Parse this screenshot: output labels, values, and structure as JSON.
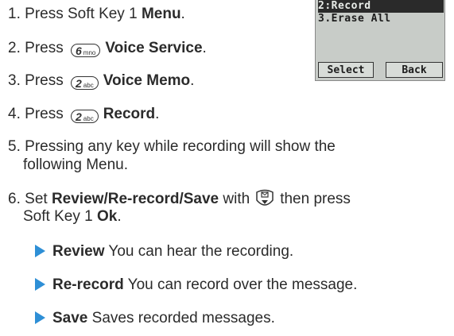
{
  "steps": [
    {
      "num": "1.",
      "pre": "Press Soft Key 1 ",
      "bold": "Menu",
      "post": "."
    },
    {
      "num": "2.",
      "pre": "Press ",
      "key": {
        "digit": "6",
        "letters": "mno"
      },
      "bold": "Voice Service",
      "post": "."
    },
    {
      "num": "3.",
      "pre": "Press ",
      "key": {
        "digit": "2",
        "letters": "abc"
      },
      "bold": "Voice Memo",
      "post": "."
    },
    {
      "num": "4.",
      "pre": "Press ",
      "key": {
        "digit": "2",
        "letters": "abc"
      },
      "bold": "Record",
      "post": "."
    },
    {
      "num": "5.",
      "line1": "Pressing any key while recording will show the",
      "line2": "following Menu."
    },
    {
      "num": "6.",
      "pre": "Set ",
      "bold_a": "Review",
      "slash1": "/",
      "bold_b": "Re-record",
      "slash2": "/",
      "bold_c": "Save",
      "mid": " with",
      "after_icon": "then press",
      "line2_pre": "Soft Key 1 ",
      "line2_bold": "Ok",
      "line2_post": "."
    }
  ],
  "bullets": [
    {
      "bold": "Review",
      "text": " You can hear the recording."
    },
    {
      "bold": "Re-record",
      "text": " You can record over the message."
    },
    {
      "bold": "Save",
      "text": " Saves recorded messages."
    }
  ],
  "phone_screen": {
    "highlighted_item": "2:Record",
    "item": "3.Erase All",
    "softkey_left": "Select",
    "softkey_right": "Back"
  },
  "colors": {
    "bullet_arrow": "#2e8fd6",
    "screen_bg": "#c8ccc8"
  },
  "icons": {
    "nav_key": "navigation-key-icon",
    "bullet": "triangle-bullet-icon"
  }
}
